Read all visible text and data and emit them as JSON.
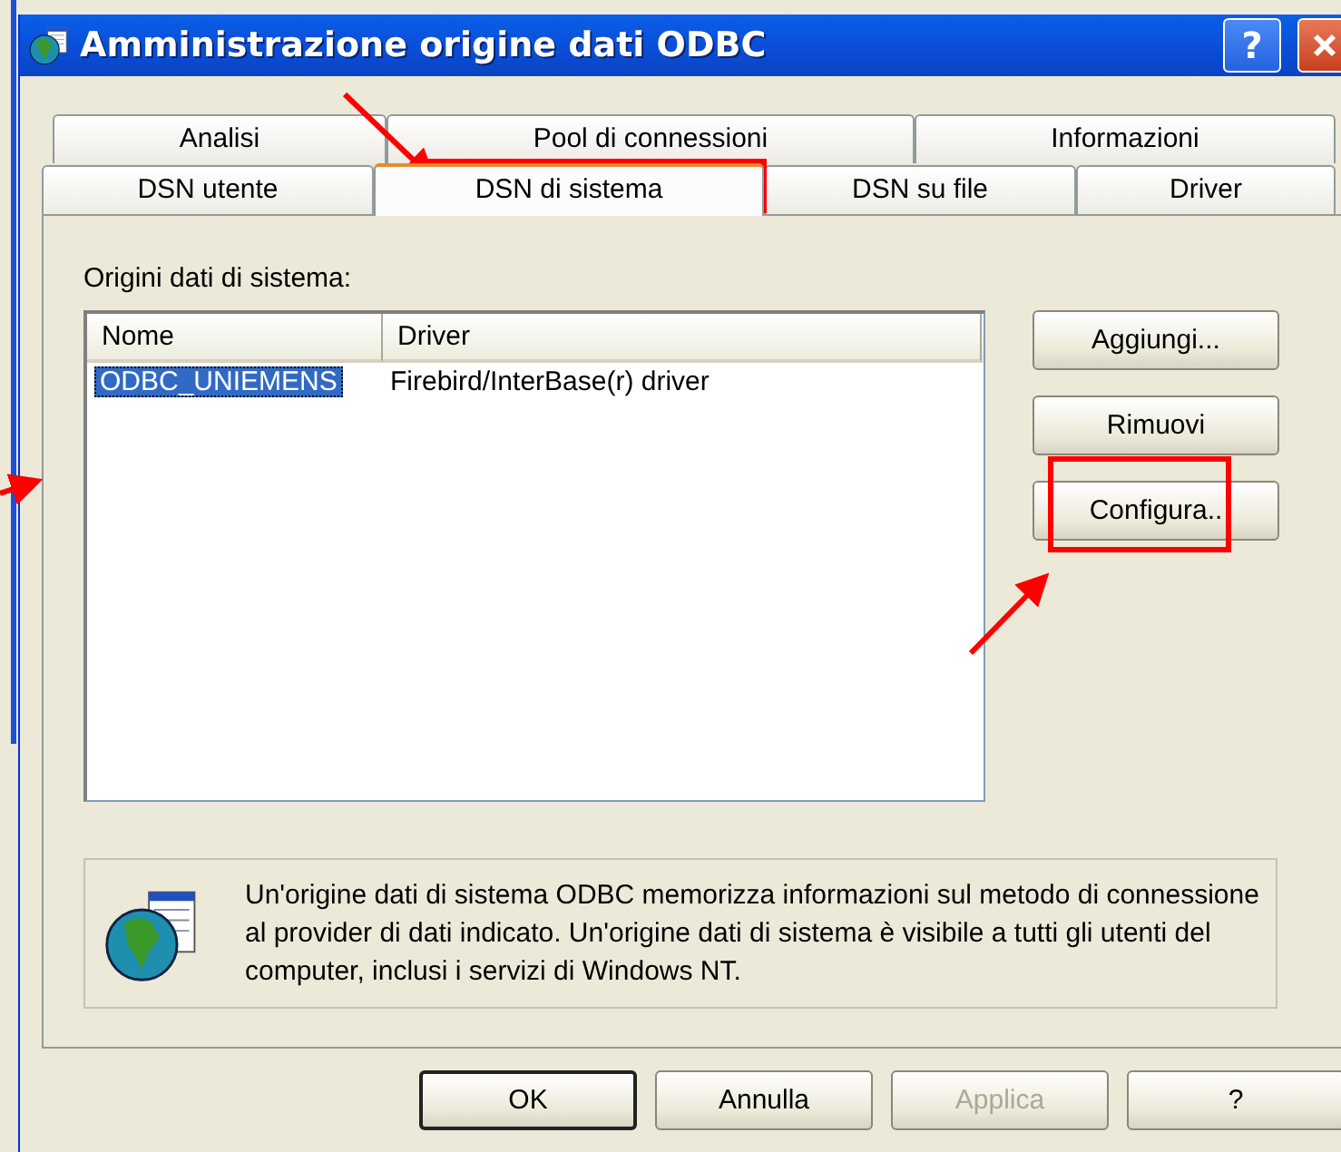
{
  "window": {
    "title": "Amministrazione origine dati ODBC",
    "help_label": "?"
  },
  "tabs": [
    [
      {
        "label": "Analisi",
        "selected": false
      },
      {
        "label": "Pool di connessioni",
        "selected": false
      },
      {
        "label": "Informazioni",
        "selected": false
      }
    ],
    [
      {
        "label": "DSN utente",
        "selected": false
      },
      {
        "label": "DSN di sistema",
        "selected": true
      },
      {
        "label": "DSN su file",
        "selected": false
      },
      {
        "label": "Driver",
        "selected": false
      }
    ]
  ],
  "section_label": "Origini dati di sistema:",
  "list": {
    "columns": [
      "Nome",
      "Driver"
    ],
    "rows": [
      {
        "cells": [
          "ODBC_UNIEMENS",
          "Firebird/InterBase(r) driver"
        ],
        "selected": true
      }
    ]
  },
  "side_buttons": [
    "Aggiungi...",
    "Rimuovi",
    "Configura.."
  ],
  "info_text": "Un'origine dati di sistema ODBC memorizza informazioni sul metodo di connessione al provider di dati indicato. Un'origine dati di sistema è visibile a tutti gli utenti del computer, inclusi i servizi di Windows NT.",
  "dialog_buttons": [
    {
      "label": "OK",
      "default": true,
      "disabled": false
    },
    {
      "label": "Annulla",
      "default": false,
      "disabled": false
    },
    {
      "label": "Applica",
      "default": false,
      "disabled": true
    },
    {
      "label": "?",
      "default": false,
      "disabled": false
    }
  ]
}
